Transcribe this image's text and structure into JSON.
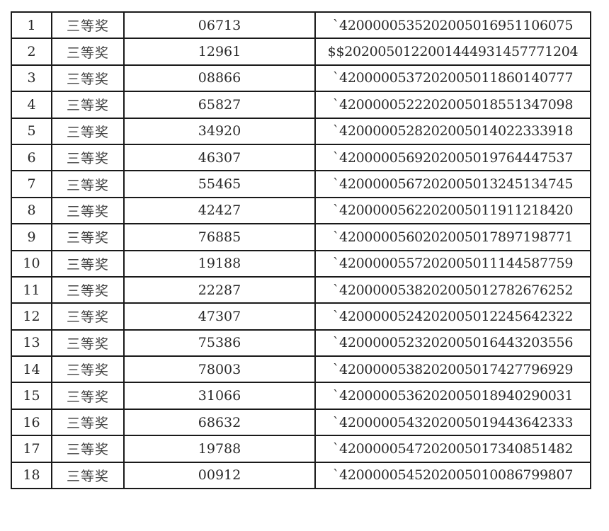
{
  "table": {
    "rows": [
      [
        "1",
        "三等奖",
        "06713",
        "`42000005352020050169511060​75"
      ],
      [
        "2",
        "三等奖",
        "12961",
        "$$202005012200144493145777​1204"
      ],
      [
        "3",
        "三等奖",
        "08866",
        "`420000053720200501186014077​7"
      ],
      [
        "4",
        "三等奖",
        "65827",
        "`420000052220200501855134709​8"
      ],
      [
        "5",
        "三等奖",
        "34920",
        "`420000052820200501402233391​8"
      ],
      [
        "6",
        "三等奖",
        "46307",
        "`420000056920200501976444753​7"
      ],
      [
        "7",
        "三等奖",
        "55465",
        "`420000056720200501324513474​5"
      ],
      [
        "8",
        "三等奖",
        "42427",
        "`420000056220200501191121842​0"
      ],
      [
        "9",
        "三等奖",
        "76885",
        "`420000056020200501789719877​1"
      ],
      [
        "10",
        "三等奖",
        "19188",
        "`420000055720200501114458775​9"
      ],
      [
        "11",
        "三等奖",
        "22287",
        "`420000053820200501278267625​2"
      ],
      [
        "12",
        "三等奖",
        "47307",
        "`420000052420200501224564232​2"
      ],
      [
        "13",
        "三等奖",
        "75386",
        "`420000052320200501644320355​6"
      ],
      [
        "14",
        "三等奖",
        "78003",
        "`420000053820200501742779692​9"
      ],
      [
        "15",
        "三等奖",
        "31066",
        "`420000053620200501894029003​1"
      ],
      [
        "16",
        "三等奖",
        "68632",
        "`420000054320200501944364233​3"
      ],
      [
        "17",
        "三等奖",
        "19788",
        "`420000054720200501734085148​2"
      ],
      [
        "18",
        "三等奖",
        "00912",
        "`420000054520200501008679980​7"
      ]
    ]
  }
}
